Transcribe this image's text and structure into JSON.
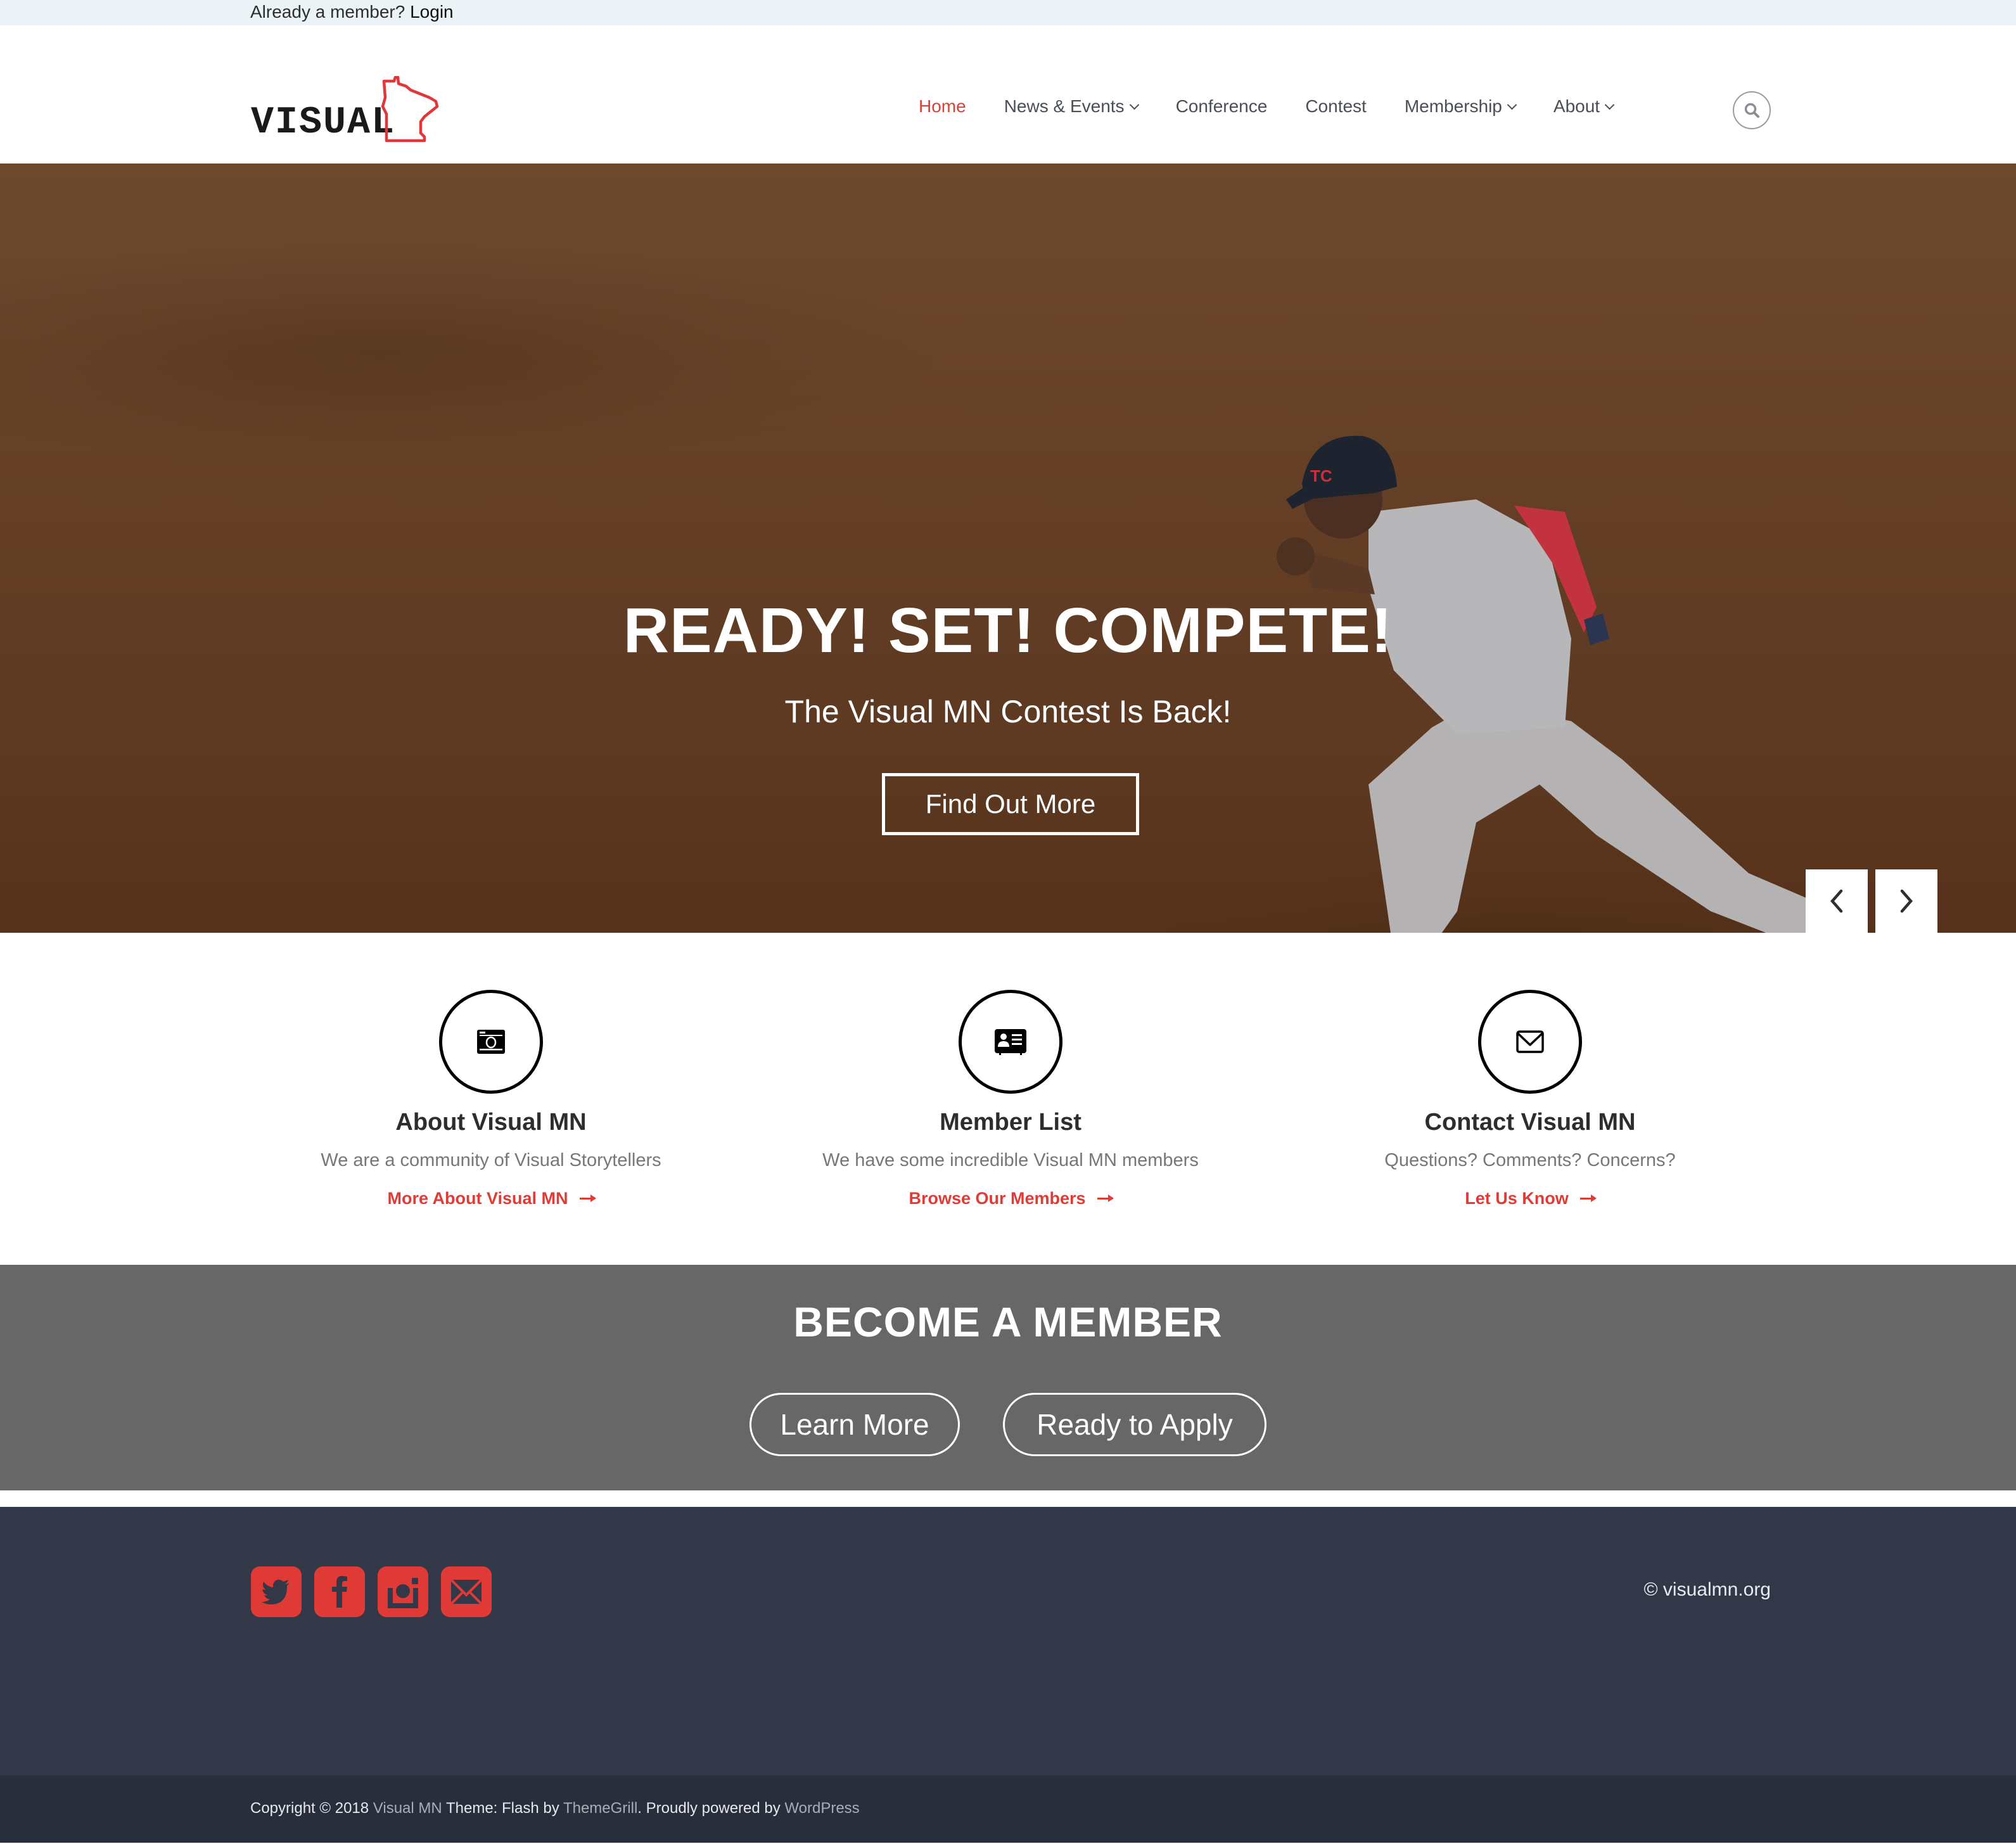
{
  "topbar": {
    "prompt": "Already a member? ",
    "login_label": "Login"
  },
  "header": {
    "logo_text": "VISUAL",
    "nav": [
      {
        "label": "Home",
        "active": true,
        "dropdown": false
      },
      {
        "label": "News & Events",
        "active": false,
        "dropdown": true
      },
      {
        "label": "Conference",
        "active": false,
        "dropdown": false
      },
      {
        "label": "Contest",
        "active": false,
        "dropdown": false
      },
      {
        "label": "Membership",
        "active": false,
        "dropdown": true
      },
      {
        "label": "About",
        "active": false,
        "dropdown": true
      }
    ],
    "search_icon": "search-icon"
  },
  "hero": {
    "title": "READY! SET! COMPETE!",
    "subtitle": "The Visual MN Contest Is Back!",
    "button_label": "Find Out More",
    "prev_icon": "chevron-left-icon",
    "next_icon": "chevron-right-icon"
  },
  "features": [
    {
      "icon": "camera-icon",
      "title": "About Visual MN",
      "description": "We are a community of Visual Storytellers",
      "link_label": "More About Visual MN"
    },
    {
      "icon": "id-card-icon",
      "title": "Member List",
      "description": "We have some incredible Visual MN members",
      "link_label": "Browse Our Members"
    },
    {
      "icon": "envelope-icon",
      "title": "Contact Visual MN",
      "description": "Questions? Comments? Concerns?",
      "link_label": "Let Us Know"
    }
  ],
  "cta": {
    "title": "BECOME A MEMBER",
    "buttons": [
      "Learn More",
      "Ready to Apply"
    ]
  },
  "footer": {
    "social": [
      "twitter-icon",
      "facebook-icon",
      "instagram-icon",
      "email-icon"
    ],
    "copyright_site": "© visualmn.org",
    "bottom": {
      "prefix": "Copyright © 2018 ",
      "site_link": "Visual MN",
      "theme_text": " Theme: Flash by ",
      "theme_link": "ThemeGrill",
      "powered_text": ". Proudly powered by ",
      "wp_link": "WordPress"
    }
  },
  "colors": {
    "accent": "#e03c36",
    "nav_active": "#d6433b",
    "cta_bg": "#676767",
    "footer_bg": "#323848",
    "bottom_bg": "#282e3c",
    "topbar_bg": "#ecf3f6"
  }
}
